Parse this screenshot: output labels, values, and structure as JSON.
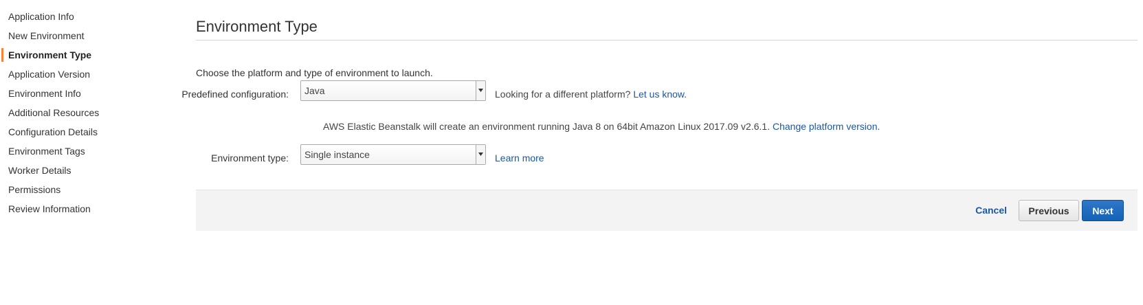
{
  "sidebar": {
    "items": [
      {
        "label": "Application Info"
      },
      {
        "label": "New Environment"
      },
      {
        "label": "Environment Type"
      },
      {
        "label": "Application Version"
      },
      {
        "label": "Environment Info"
      },
      {
        "label": "Additional Resources"
      },
      {
        "label": "Configuration Details"
      },
      {
        "label": "Environment Tags"
      },
      {
        "label": "Worker Details"
      },
      {
        "label": "Permissions"
      },
      {
        "label": "Review Information"
      }
    ],
    "active_label": "Environment Type",
    "active_color": "#f58534"
  },
  "main": {
    "title": "Environment Type",
    "intro": "Choose the platform and type of environment to launch.",
    "predefined": {
      "label": "Predefined configuration:",
      "value": "Java",
      "hint_text": "Looking for a different platform?",
      "hint_link": "Let us know",
      "hint_suffix": "."
    },
    "description": {
      "text": "AWS Elastic Beanstalk will create an environment running Java 8 on 64bit Amazon Linux 2017.09 v2.6.1.",
      "link": "Change platform version",
      "suffix": "."
    },
    "env_type": {
      "label": "Environment type:",
      "value": "Single instance",
      "link": "Learn more"
    }
  },
  "footer": {
    "cancel_label": "Cancel",
    "previous_label": "Previous",
    "next_label": "Next"
  },
  "colors": {
    "link": "#1a57a6",
    "primary_button": "#1462b6",
    "footer_bg": "#f3f3f3"
  }
}
